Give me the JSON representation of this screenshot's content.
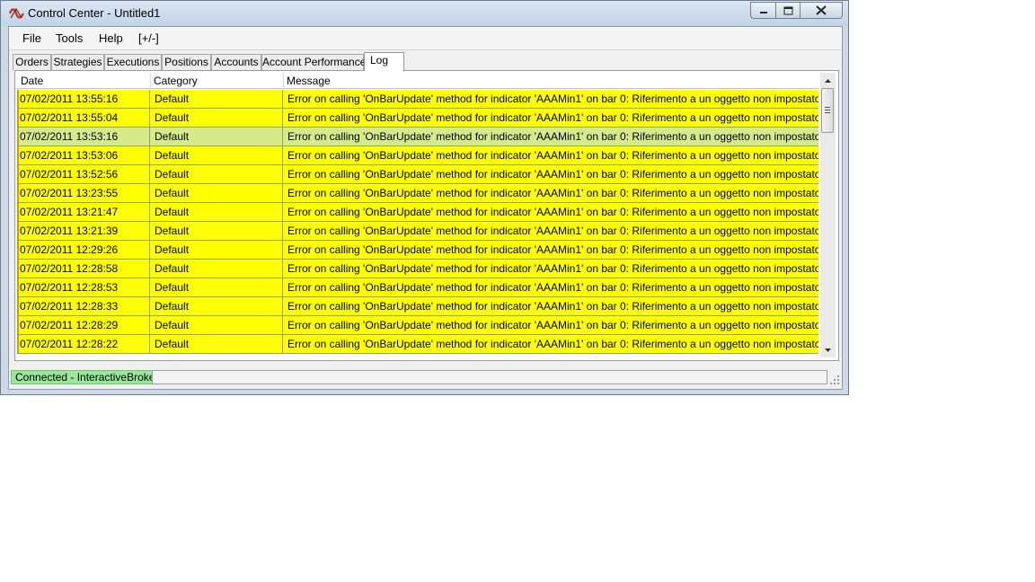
{
  "window": {
    "title": "Control Center - Untitled1"
  },
  "menu": {
    "items": [
      "File",
      "Tools",
      "Help",
      "[+/-]"
    ]
  },
  "tabs": [
    "Orders",
    "Strategies",
    "Executions",
    "Positions",
    "Accounts",
    "Account Performance",
    "Log"
  ],
  "active_tab": "Log",
  "log": {
    "columns": [
      "Date",
      "Category",
      "Message"
    ],
    "selected_row_index": 2,
    "rows": [
      {
        "date": "07/02/2011 13:55:16",
        "category": "Default",
        "message": "Error on calling 'OnBarUpdate' method for indicator 'AAAMin1' on bar 0: Riferimento a un oggetto non impostato su u"
      },
      {
        "date": "07/02/2011 13:55:04",
        "category": "Default",
        "message": "Error on calling 'OnBarUpdate' method for indicator 'AAAMin1' on bar 0: Riferimento a un oggetto non impostato su u"
      },
      {
        "date": "07/02/2011 13:53:16",
        "category": "Default",
        "message": "Error on calling 'OnBarUpdate' method for indicator 'AAAMin1' on bar 0: Riferimento a un oggetto non impostato su u"
      },
      {
        "date": "07/02/2011 13:53:06",
        "category": "Default",
        "message": "Error on calling 'OnBarUpdate' method for indicator 'AAAMin1' on bar 0: Riferimento a un oggetto non impostato su u"
      },
      {
        "date": "07/02/2011 13:52:56",
        "category": "Default",
        "message": "Error on calling 'OnBarUpdate' method for indicator 'AAAMin1' on bar 0: Riferimento a un oggetto non impostato su u"
      },
      {
        "date": "07/02/2011 13:23:55",
        "category": "Default",
        "message": "Error on calling 'OnBarUpdate' method for indicator 'AAAMin1' on bar 0: Riferimento a un oggetto non impostato su u"
      },
      {
        "date": "07/02/2011 13:21:47",
        "category": "Default",
        "message": "Error on calling 'OnBarUpdate' method for indicator 'AAAMin1' on bar 0: Riferimento a un oggetto non impostato su u"
      },
      {
        "date": "07/02/2011 13:21:39",
        "category": "Default",
        "message": "Error on calling 'OnBarUpdate' method for indicator 'AAAMin1' on bar 0: Riferimento a un oggetto non impostato su u"
      },
      {
        "date": "07/02/2011 12:29:26",
        "category": "Default",
        "message": "Error on calling 'OnBarUpdate' method for indicator 'AAAMin1' on bar 0: Riferimento a un oggetto non impostato su u"
      },
      {
        "date": "07/02/2011 12:28:58",
        "category": "Default",
        "message": "Error on calling 'OnBarUpdate' method for indicator 'AAAMin1' on bar 0: Riferimento a un oggetto non impostato su u"
      },
      {
        "date": "07/02/2011 12:28:53",
        "category": "Default",
        "message": "Error on calling 'OnBarUpdate' method for indicator 'AAAMin1' on bar 0: Riferimento a un oggetto non impostato su u"
      },
      {
        "date": "07/02/2011 12:28:33",
        "category": "Default",
        "message": "Error on calling 'OnBarUpdate' method for indicator 'AAAMin1' on bar 0: Riferimento a un oggetto non impostato su u"
      },
      {
        "date": "07/02/2011 12:28:29",
        "category": "Default",
        "message": "Error on calling 'OnBarUpdate' method for indicator 'AAAMin1' on bar 0: Riferimento a un oggetto non impostato su u"
      },
      {
        "date": "07/02/2011 12:28:22",
        "category": "Default",
        "message": "Error on calling 'OnBarUpdate' method for indicator 'AAAMin1' on bar 0: Riferimento a un oggetto non impostato su u"
      }
    ]
  },
  "status": {
    "connection": "Connected - InteractiveBrokers"
  },
  "icons": {
    "app": "app-logo-icon",
    "minimize": "minimize-icon",
    "maximize": "maximize-icon",
    "close": "close-icon",
    "scroll_up": "scroll-up-icon",
    "scroll_down": "scroll-down-icon",
    "grip": "resize-grip-icon"
  },
  "colors": {
    "row_background": "#ffff00",
    "selected_row_background": "#d6ea8c",
    "connection_status": "#98e898"
  }
}
